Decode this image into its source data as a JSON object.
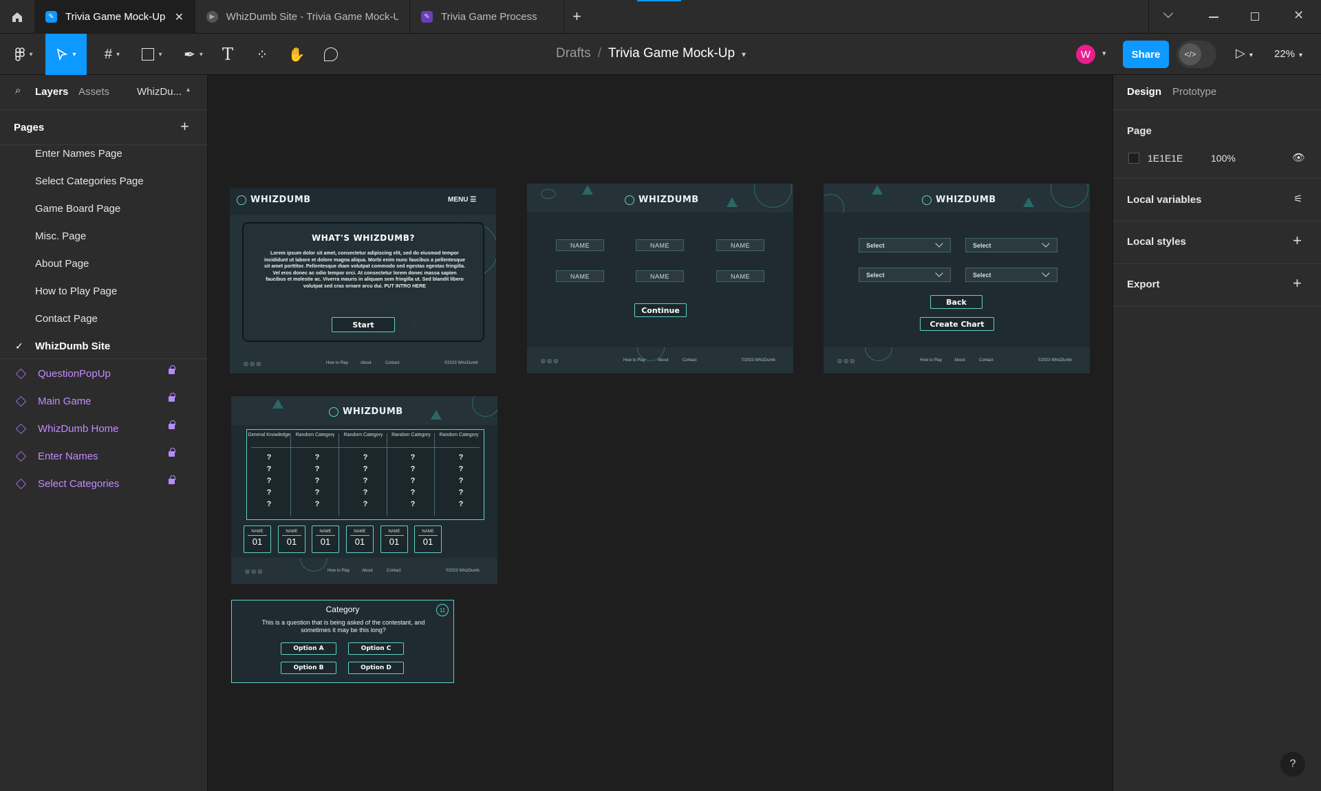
{
  "tabs": [
    {
      "label": "Trivia Game Mock-Up",
      "active": true
    },
    {
      "label": "WhizDumb Site - Trivia Game Mock-U",
      "active": false
    },
    {
      "label": "Trivia Game Process",
      "active": false
    }
  ],
  "toolbar": {
    "breadcrumb_parent": "Drafts",
    "breadcrumb_sep": "/",
    "file_name": "Trivia Game Mock-Up",
    "avatar_letter": "W",
    "share_label": "Share",
    "zoom": "22%"
  },
  "left_panel": {
    "tab_layers": "Layers",
    "tab_assets": "Assets",
    "tab_file": "WhizDu...",
    "pages_title": "Pages",
    "pages": [
      "Enter Names Page",
      "Select Categories Page",
      "Game Board Page",
      "Misc. Page",
      "About Page",
      "How to Play Page",
      "Contact Page",
      "WhizDumb Site"
    ],
    "current_page": "WhizDumb Site",
    "layers": [
      "QuestionPopUp",
      "Main Game",
      "WhizDumb Home",
      "Enter Names",
      "Select Categories"
    ]
  },
  "right_panel": {
    "tab_design": "Design",
    "tab_prototype": "Prototype",
    "page_title": "Page",
    "page_color": "1E1E1E",
    "page_opacity": "100%",
    "local_variables": "Local variables",
    "local_styles": "Local styles",
    "export": "Export"
  },
  "mock": {
    "logo": "WHIZDUMB",
    "menu": "MENU",
    "home_title": "WHAT'S WHIZDUMB?",
    "home_body": "Lorem ipsum dolor sit amet, consectetur adipiscing elit, sed do eiusmod tempor incididunt ut labore et dolore magna aliqua. Morbi enim nunc faucibus a pellentesque sit amet porttitor. Pellentesque diam volutpat commodo sed egestas egestas fringilla. Vel eros donec ac odio tempor orci. At consectetur lorem donec massa sapien faucibus et molestie ac. Viverra mauris in aliquam sem fringilla ut. Sed blandit libero volutpat sed cras ornare arcu dui. PUT INTRO HERE",
    "start": "Start",
    "name_label": "NAME",
    "continue": "Continue",
    "select_label": "Select",
    "back": "Back",
    "create_chart": "Create Chart",
    "footer_links": [
      "How to Play",
      "About",
      "Contact"
    ],
    "copyright": "©2023 WhizDumb",
    "categories": [
      "General Knowledge",
      "Random Category",
      "Random Category",
      "Random Category",
      "Random Category"
    ],
    "cell": "?",
    "score_value": "01",
    "popup_title": "Category",
    "popup_question": "This is a question that is being asked of the contestant, and sometimes it may be this long?",
    "options": [
      "Option A",
      "Option C",
      "Option B",
      "Option D"
    ],
    "timer": "11"
  },
  "colors": {
    "accent": "#0d99ff",
    "layer_purple": "#c58bff",
    "avatar": "#e91e8c",
    "mock_teal": "#5fd3c9",
    "mock_bg": "#1f2b30"
  }
}
